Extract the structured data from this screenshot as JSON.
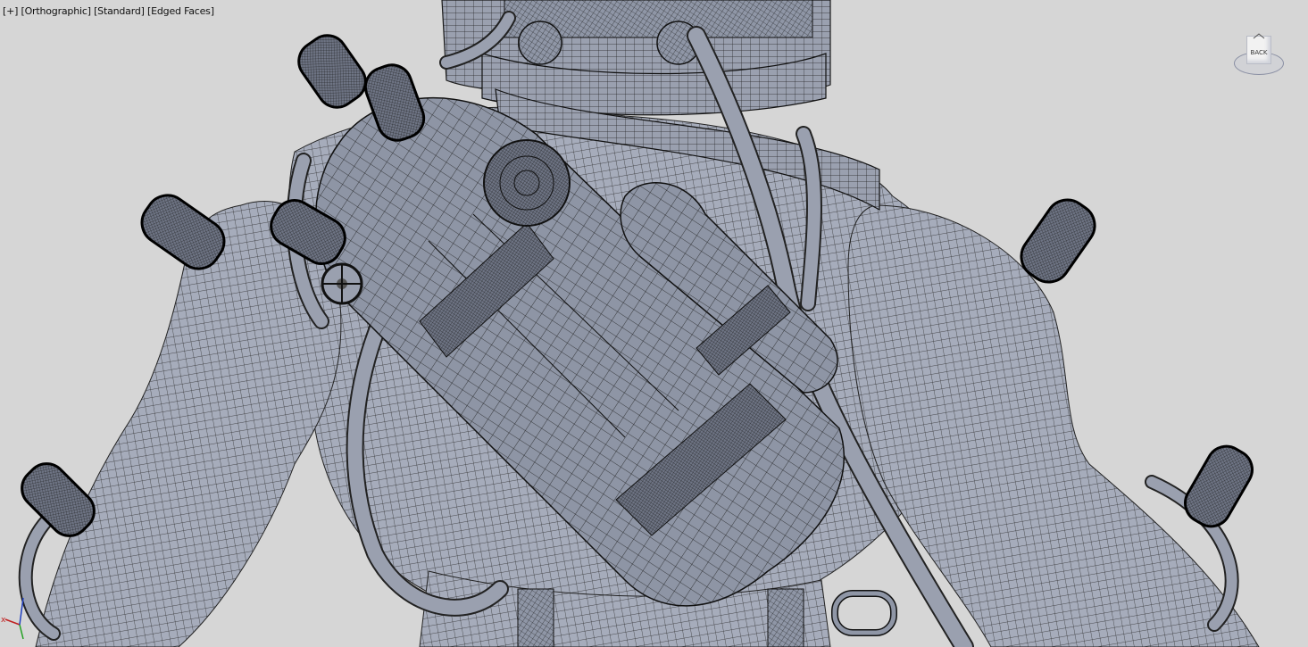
{
  "viewport": {
    "label_plus": "[+]",
    "label_view": "[Orthographic]",
    "label_shading": "[Standard]",
    "label_display": "[Edged Faces]"
  },
  "viewcube": {
    "face_label": "BACK",
    "icon": "home-icon"
  },
  "axis_gizmo": {
    "x_label": "x",
    "icon": "axis-tripod-icon"
  },
  "colors": {
    "background": "#d6d6d6",
    "mesh_fill": "#a6acbb",
    "wire": "#1c1c1c"
  }
}
